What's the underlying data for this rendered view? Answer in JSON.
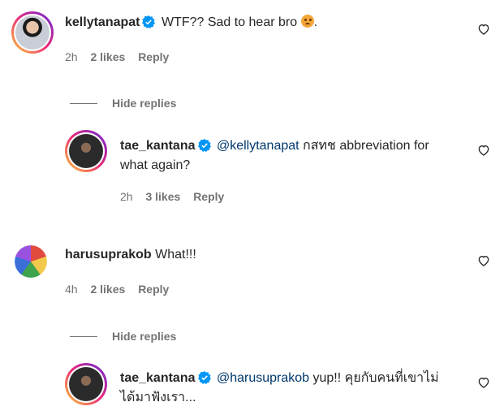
{
  "comments": [
    {
      "username": "kellytanapat",
      "text": "WTF?? Sad to hear bro",
      "text_suffix": ".",
      "emoji": "sad-face-emoji",
      "time": "2h",
      "likes": "2 likes",
      "reply": "Reply"
    },
    {
      "username": "tae_kantana",
      "mention": "@kellytanapat",
      "text_line1": "กสทช abbreviation for",
      "text_line2": "what again?",
      "time": "2h",
      "likes": "3 likes",
      "reply": "Reply"
    },
    {
      "username": "harusuprakob",
      "text": "What!!!",
      "time": "4h",
      "likes": "2 likes",
      "reply": "Reply"
    },
    {
      "username": "tae_kantana",
      "mention": "@harusuprakob",
      "text_line1": "yup!! คุยกับคนที่เขาไม่",
      "text_line2": "ได้มาฟังเรา..."
    }
  ],
  "hide_replies_label": "Hide replies",
  "colors": {
    "verified": "#0095f6",
    "mention": "#00376b",
    "meta": "#737373"
  }
}
